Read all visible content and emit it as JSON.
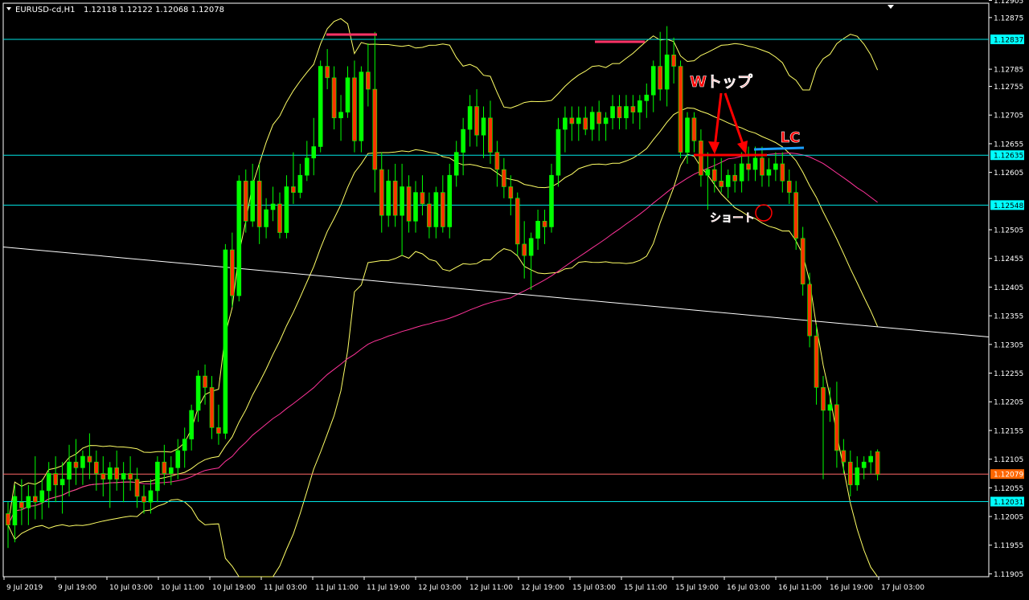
{
  "header": {
    "symbol": "EURUSD-cd,H1",
    "ohlc": "1.12118 1.12122 1.12068 1.12078"
  },
  "colors": {
    "background": "#000000",
    "axis": "#ffffff",
    "bull_candle": "#00ff00",
    "bear_candle": "#ff3300",
    "bollinger": "#ffff66",
    "ma": "#ff3399",
    "trendline": "#ffffff",
    "level_line": "#00e5e5",
    "price_line": "#ff6666",
    "marker_red": "#ff0000",
    "marker_pink": "#ff3366",
    "marker_blue": "#1a9fff",
    "tag_cyan_bg": "#00ffff",
    "tag_price_bg": "#ff6600"
  },
  "annotations": {
    "double_top": "Wトップ",
    "lc": "LC",
    "short": "ショート"
  },
  "chart_data": {
    "type": "candlestick",
    "symbol": "EURUSD-cd",
    "timeframe": "H1",
    "ylim": [
      1.119,
      1.129
    ],
    "y_ticks": [
      "1.12905",
      "1.12875",
      "1.12837",
      "1.12785",
      "1.12755",
      "1.12705",
      "1.12655",
      "1.12635",
      "1.12605",
      "1.12548",
      "1.12505",
      "1.12455",
      "1.12405",
      "1.12355",
      "1.12305",
      "1.12255",
      "1.12205",
      "1.12155",
      "1.12105",
      "1.12079",
      "1.12055",
      "1.12031",
      "1.12005",
      "1.11955",
      "1.11905"
    ],
    "x_ticks": [
      "9 Jul 2019",
      "9 Jul 19:00",
      "10 Jul 03:00",
      "10 Jul 11:00",
      "10 Jul 19:00",
      "11 Jul 03:00",
      "11 Jul 11:00",
      "11 Jul 19:00",
      "12 Jul 03:00",
      "12 Jul 11:00",
      "12 Jul 19:00",
      "15 Jul 03:00",
      "15 Jul 11:00",
      "15 Jul 19:00",
      "16 Jul 03:00",
      "16 Jul 11:00",
      "16 Jul 19:00",
      "17 Jul 03:00"
    ],
    "horizontal_lines": [
      {
        "price": 1.12837,
        "label": "1.12837",
        "style": "level"
      },
      {
        "price": 1.12635,
        "label": "1.12635",
        "style": "level"
      },
      {
        "price": 1.12548,
        "label": "1.12548",
        "style": "level"
      },
      {
        "price": 1.12079,
        "label": "1.12079",
        "style": "price"
      },
      {
        "price": 1.12031,
        "label": "1.12031",
        "style": "level"
      }
    ],
    "candles": [
      [
        1.1201,
        1.1203,
        1.1195,
        1.1199
      ],
      [
        1.1199,
        1.1206,
        1.1196,
        1.1204
      ],
      [
        1.1203,
        1.1207,
        1.1199,
        1.1202
      ],
      [
        1.1202,
        1.1206,
        1.1199,
        1.1204
      ],
      [
        1.1204,
        1.1211,
        1.12,
        1.1203
      ],
      [
        1.1203,
        1.1207,
        1.12,
        1.1205
      ],
      [
        1.1205,
        1.121,
        1.1202,
        1.1208
      ],
      [
        1.1208,
        1.1211,
        1.1203,
        1.1206
      ],
      [
        1.1206,
        1.121,
        1.1201,
        1.1207
      ],
      [
        1.1207,
        1.1213,
        1.1204,
        1.121
      ],
      [
        1.121,
        1.1214,
        1.1206,
        1.1209
      ],
      [
        1.1209,
        1.1212,
        1.1206,
        1.1211
      ],
      [
        1.1211,
        1.1215,
        1.1207,
        1.121
      ],
      [
        1.121,
        1.1212,
        1.1205,
        1.1208
      ],
      [
        1.1208,
        1.1211,
        1.1204,
        1.1207
      ],
      [
        1.1207,
        1.121,
        1.1202,
        1.1209
      ],
      [
        1.1209,
        1.1212,
        1.1205,
        1.1207
      ],
      [
        1.1207,
        1.121,
        1.1203,
        1.1208
      ],
      [
        1.1208,
        1.1211,
        1.1205,
        1.1207
      ],
      [
        1.1207,
        1.1209,
        1.1202,
        1.1204
      ],
      [
        1.1204,
        1.1206,
        1.1201,
        1.1203
      ],
      [
        1.1203,
        1.1207,
        1.1201,
        1.1205
      ],
      [
        1.1205,
        1.1211,
        1.1203,
        1.121
      ],
      [
        1.121,
        1.1213,
        1.1206,
        1.1208
      ],
      [
        1.1208,
        1.1211,
        1.1206,
        1.1209
      ],
      [
        1.1209,
        1.1214,
        1.1207,
        1.1212
      ],
      [
        1.1212,
        1.1216,
        1.1209,
        1.1214
      ],
      [
        1.1214,
        1.122,
        1.1212,
        1.1219
      ],
      [
        1.1219,
        1.1226,
        1.1217,
        1.1225
      ],
      [
        1.1225,
        1.1227,
        1.122,
        1.1223
      ],
      [
        1.1223,
        1.1225,
        1.1214,
        1.1216
      ],
      [
        1.1216,
        1.122,
        1.1213,
        1.1215
      ],
      [
        1.1215,
        1.1248,
        1.1214,
        1.1247
      ],
      [
        1.1247,
        1.125,
        1.1237,
        1.1239
      ],
      [
        1.1239,
        1.126,
        1.1238,
        1.1259
      ],
      [
        1.1259,
        1.1261,
        1.125,
        1.1252
      ],
      [
        1.1252,
        1.1262,
        1.1251,
        1.1259
      ],
      [
        1.1259,
        1.1262,
        1.1248,
        1.1251
      ],
      [
        1.1251,
        1.1256,
        1.1249,
        1.1254
      ],
      [
        1.1254,
        1.1258,
        1.1252,
        1.1255
      ],
      [
        1.1255,
        1.1257,
        1.1249,
        1.125
      ],
      [
        1.125,
        1.126,
        1.1249,
        1.1258
      ],
      [
        1.1258,
        1.1264,
        1.1255,
        1.1257
      ],
      [
        1.1257,
        1.1262,
        1.1256,
        1.126
      ],
      [
        1.126,
        1.1266,
        1.1259,
        1.1263
      ],
      [
        1.1263,
        1.127,
        1.126,
        1.1265
      ],
      [
        1.1265,
        1.128,
        1.1264,
        1.1279
      ],
      [
        1.1279,
        1.1282,
        1.1275,
        1.1277
      ],
      [
        1.1277,
        1.1279,
        1.1268,
        1.127
      ],
      [
        1.127,
        1.1274,
        1.1266,
        1.1271
      ],
      [
        1.1271,
        1.1279,
        1.127,
        1.1277
      ],
      [
        1.1277,
        1.128,
        1.1264,
        1.1266
      ],
      [
        1.1266,
        1.1279,
        1.1264,
        1.1278
      ],
      [
        1.1278,
        1.1283,
        1.1272,
        1.1275
      ],
      [
        1.1275,
        1.1285,
        1.1257,
        1.1261
      ],
      [
        1.1261,
        1.1264,
        1.125,
        1.1253
      ],
      [
        1.1253,
        1.1261,
        1.1251,
        1.1259
      ],
      [
        1.1259,
        1.1262,
        1.1251,
        1.1253
      ],
      [
        1.1253,
        1.1262,
        1.1246,
        1.1258
      ],
      [
        1.1258,
        1.126,
        1.125,
        1.1252
      ],
      [
        1.1252,
        1.1259,
        1.125,
        1.1257
      ],
      [
        1.1257,
        1.126,
        1.1253,
        1.1255
      ],
      [
        1.1255,
        1.1257,
        1.1249,
        1.1251
      ],
      [
        1.1251,
        1.1258,
        1.1249,
        1.1257
      ],
      [
        1.1257,
        1.126,
        1.125,
        1.1251
      ],
      [
        1.1251,
        1.1262,
        1.1249,
        1.126
      ],
      [
        1.126,
        1.1266,
        1.1258,
        1.1264
      ],
      [
        1.1264,
        1.127,
        1.126,
        1.1268
      ],
      [
        1.1268,
        1.1274,
        1.1265,
        1.1272
      ],
      [
        1.1272,
        1.1275,
        1.1265,
        1.1267
      ],
      [
        1.1267,
        1.1272,
        1.1263,
        1.127
      ],
      [
        1.127,
        1.1273,
        1.1262,
        1.1264
      ],
      [
        1.1264,
        1.1266,
        1.1258,
        1.1261
      ],
      [
        1.1261,
        1.1263,
        1.1256,
        1.1258
      ],
      [
        1.1258,
        1.126,
        1.1253,
        1.1256
      ],
      [
        1.1256,
        1.1257,
        1.1246,
        1.1248
      ],
      [
        1.1248,
        1.1252,
        1.1242,
        1.1246
      ],
      [
        1.1246,
        1.125,
        1.124,
        1.1249
      ],
      [
        1.1249,
        1.1254,
        1.1247,
        1.1252
      ],
      [
        1.1252,
        1.1254,
        1.1248,
        1.1251
      ],
      [
        1.1251,
        1.1262,
        1.125,
        1.126
      ],
      [
        1.126,
        1.127,
        1.1258,
        1.1268
      ],
      [
        1.1268,
        1.1272,
        1.1264,
        1.127
      ],
      [
        1.127,
        1.1272,
        1.1266,
        1.1269
      ],
      [
        1.1269,
        1.1272,
        1.1266,
        1.127
      ],
      [
        1.127,
        1.1272,
        1.1267,
        1.1268
      ],
      [
        1.1268,
        1.1272,
        1.1266,
        1.1271
      ],
      [
        1.1271,
        1.1273,
        1.1266,
        1.1269
      ],
      [
        1.1269,
        1.1271,
        1.1266,
        1.127
      ],
      [
        1.127,
        1.1274,
        1.1268,
        1.1272
      ],
      [
        1.1272,
        1.1274,
        1.1268,
        1.127
      ],
      [
        1.127,
        1.1274,
        1.1268,
        1.1272
      ],
      [
        1.1272,
        1.1274,
        1.1269,
        1.1271
      ],
      [
        1.1271,
        1.1274,
        1.1268,
        1.1273
      ],
      [
        1.1273,
        1.1276,
        1.127,
        1.1274
      ],
      [
        1.1274,
        1.128,
        1.1271,
        1.1279
      ],
      [
        1.1279,
        1.1285,
        1.1273,
        1.1275
      ],
      [
        1.1275,
        1.1286,
        1.1272,
        1.1281
      ],
      [
        1.1281,
        1.1284,
        1.1276,
        1.1279
      ],
      [
        1.1279,
        1.128,
        1.1263,
        1.1264
      ],
      [
        1.1264,
        1.1271,
        1.1262,
        1.127
      ],
      [
        1.127,
        1.1271,
        1.1264,
        1.1266
      ],
      [
        1.1266,
        1.1268,
        1.1258,
        1.126
      ],
      [
        1.126,
        1.1264,
        1.1254,
        1.1261
      ],
      [
        1.1261,
        1.1263,
        1.1257,
        1.1259
      ],
      [
        1.1259,
        1.1263,
        1.1257,
        1.1258
      ],
      [
        1.1258,
        1.1261,
        1.1256,
        1.126
      ],
      [
        1.126,
        1.1262,
        1.1257,
        1.1259
      ],
      [
        1.1259,
        1.1264,
        1.1257,
        1.1262
      ],
      [
        1.1262,
        1.1265,
        1.1259,
        1.1261
      ],
      [
        1.1261,
        1.1265,
        1.1259,
        1.1263
      ],
      [
        1.1263,
        1.1265,
        1.1258,
        1.126
      ],
      [
        1.126,
        1.1263,
        1.1258,
        1.1261
      ],
      [
        1.1261,
        1.1264,
        1.1259,
        1.1262
      ],
      [
        1.1262,
        1.1264,
        1.1257,
        1.1259
      ],
      [
        1.1259,
        1.1261,
        1.1255,
        1.1257
      ],
      [
        1.1257,
        1.1259,
        1.1247,
        1.1249
      ],
      [
        1.1249,
        1.1251,
        1.1239,
        1.1241
      ],
      [
        1.1241,
        1.1243,
        1.123,
        1.1232
      ],
      [
        1.1232,
        1.1234,
        1.122,
        1.1223
      ],
      [
        1.1223,
        1.1225,
        1.1207,
        1.1219
      ],
      [
        1.1219,
        1.1223,
        1.1217,
        1.122
      ],
      [
        1.122,
        1.1224,
        1.1209,
        1.1212
      ],
      [
        1.1212,
        1.1214,
        1.1208,
        1.121
      ],
      [
        1.121,
        1.1212,
        1.1204,
        1.1206
      ],
      [
        1.1206,
        1.1211,
        1.1205,
        1.1209
      ],
      [
        1.1209,
        1.1211,
        1.1207,
        1.121
      ],
      [
        1.121,
        1.1212,
        1.1208,
        1.1211
      ],
      [
        1.12118,
        1.12122,
        1.12068,
        1.12078
      ]
    ]
  }
}
